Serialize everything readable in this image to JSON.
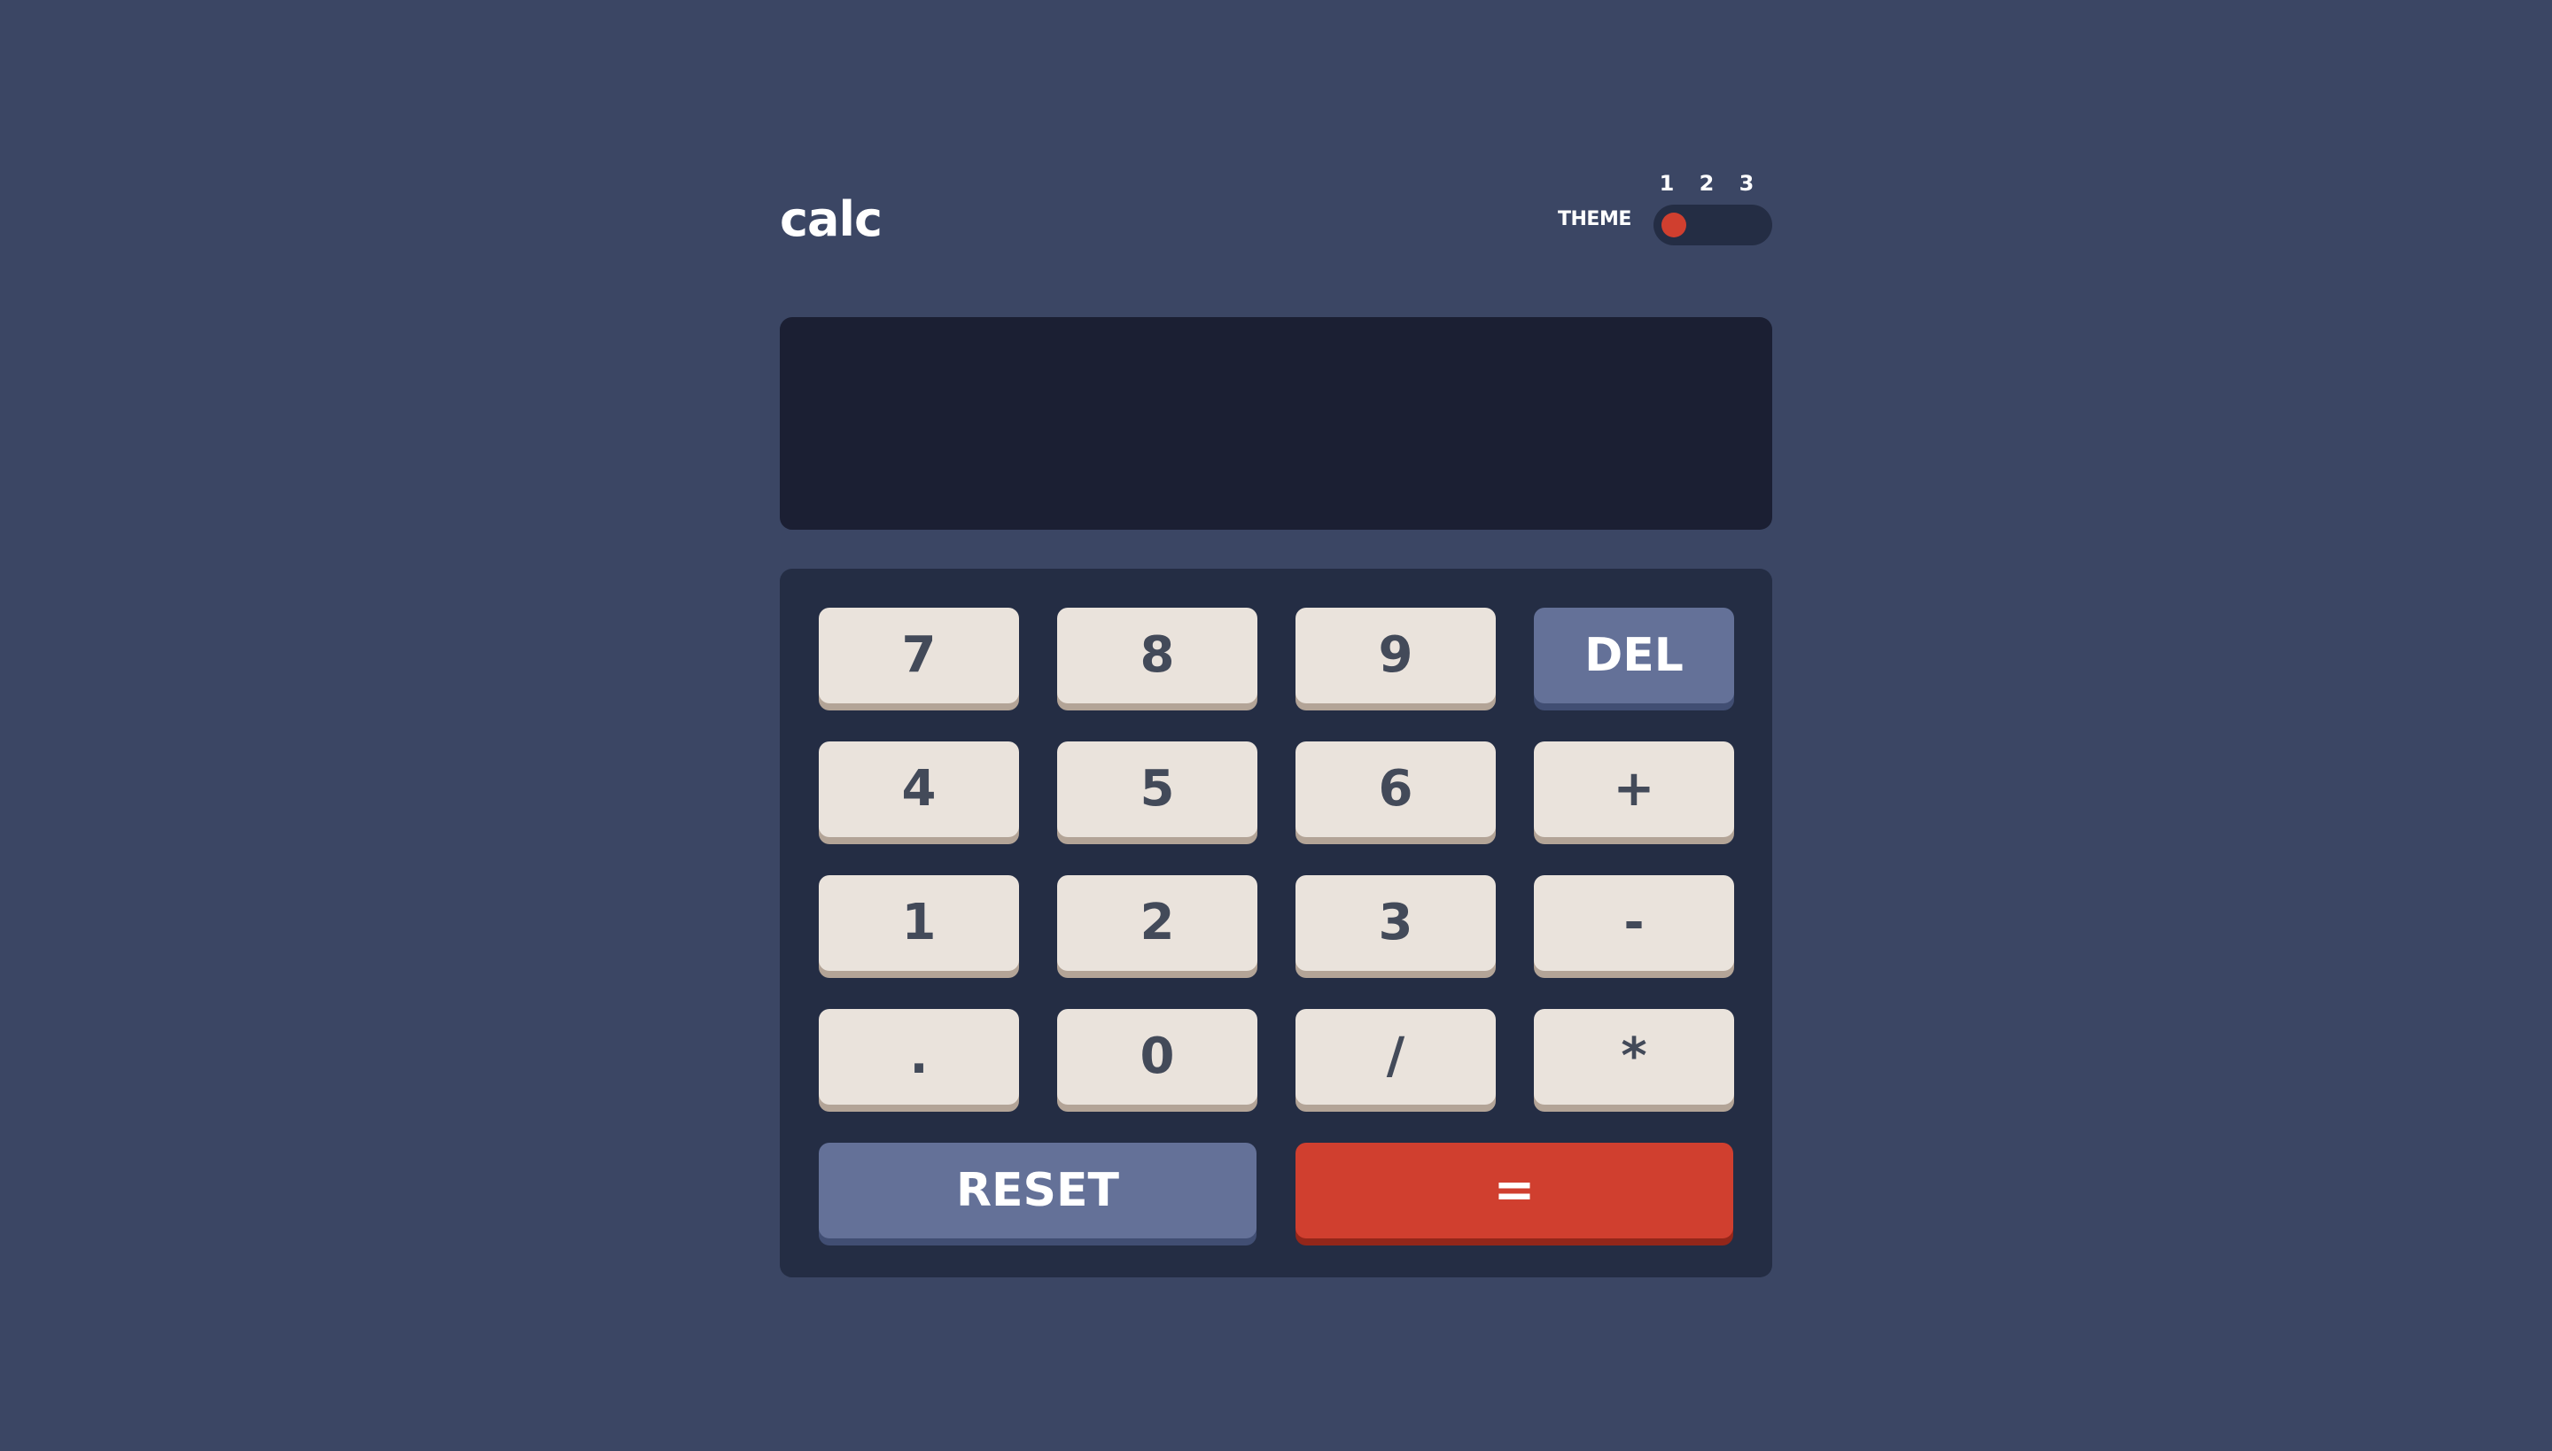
{
  "app": {
    "logo": "calc"
  },
  "theme": {
    "label": "THEME",
    "options": [
      "1",
      "2",
      "3"
    ],
    "selected": "1",
    "knob_color": "#d03f2f"
  },
  "screen": {
    "value": ""
  },
  "keypad": {
    "rows": [
      [
        "7",
        "8",
        "9",
        "DEL"
      ],
      [
        "4",
        "5",
        "6",
        "+"
      ],
      [
        "1",
        "2",
        "3",
        "-"
      ],
      [
        ".",
        "0",
        "/",
        "*"
      ],
      [
        "RESET",
        "="
      ]
    ]
  },
  "colors": {
    "background": "#3b4664",
    "screen": "#1b1f33",
    "keypad": "#242d44",
    "key": "#eae3dc",
    "key_shadow": "#b3a497",
    "key_text": "#434a59",
    "accent_blue": "#647198",
    "accent_red": "#d03f2f"
  }
}
